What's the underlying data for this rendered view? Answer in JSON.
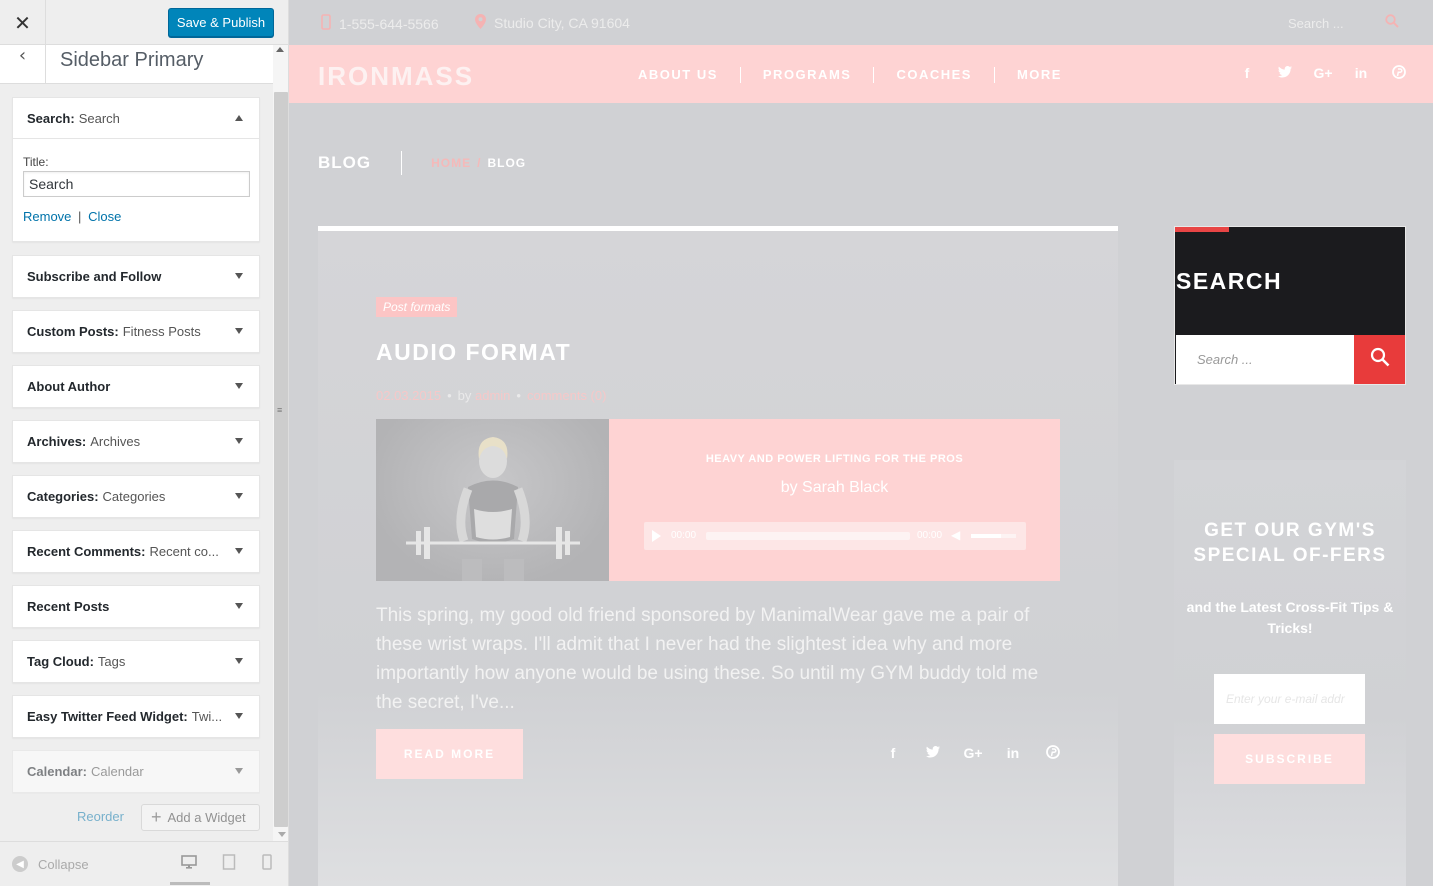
{
  "panel": {
    "close_glyph": "✕",
    "save_label": "Save & Publish",
    "back_glyph": "‹",
    "section_title": "Sidebar Primary",
    "search_widget": {
      "name": "Search:",
      "sub": "Search",
      "title_label": "Title:",
      "title_value": "Search",
      "remove_label": "Remove",
      "separator": "|",
      "close_label": "Close"
    },
    "widgets": [
      {
        "name": "Subscribe and Follow",
        "sub": ""
      },
      {
        "name": "Custom Posts:",
        "sub": "Fitness Posts"
      },
      {
        "name": "About Author",
        "sub": ""
      },
      {
        "name": "Archives:",
        "sub": "Archives"
      },
      {
        "name": "Categories:",
        "sub": "Categories"
      },
      {
        "name": "Recent Comments:",
        "sub": "Recent co..."
      },
      {
        "name": "Recent Posts",
        "sub": ""
      },
      {
        "name": "Tag Cloud:",
        "sub": "Tags"
      },
      {
        "name": "Easy Twitter Feed Widget:",
        "sub": "Twi..."
      },
      {
        "name": "Calendar:",
        "sub": "Calendar"
      }
    ],
    "reorder_label": "Reorder",
    "add_widget_label": "Add a Widget",
    "collapse_label": "Collapse",
    "scroll_grip": "≡"
  },
  "site": {
    "topbar": {
      "phone": "1-555-644-5566",
      "location": "Studio City, CA 91604",
      "search_placeholder": "Search ..."
    },
    "logo": "IRONMASS",
    "nav": [
      "ABOUT US",
      "PROGRAMS",
      "COACHES",
      "MORE"
    ],
    "social": [
      "f",
      "t",
      "G+",
      "in",
      "p"
    ],
    "page_title": "BLOG",
    "breadcrumb": {
      "home": "HOME",
      "sep": "/",
      "current": "BLOG"
    },
    "post": {
      "tag": "Post formats",
      "title": "AUDIO FORMAT",
      "date": "02.03.2015",
      "by": "by",
      "author": "admin",
      "comments": "comments (0)",
      "audio_title": "HEAVY AND POWER LIFTING FOR THE PROS",
      "audio_artist": "by Sarah Black",
      "time_start": "00:00",
      "time_end": "00:00",
      "excerpt": "This spring, my good old friend sponsored by ManimalWear gave me a pair of these wrist wraps. I'll admit that I never had the slightest idea why and more importantly how anyone would be using these. So until my GYM buddy told me the secret, I've...",
      "read_more": "READ MORE"
    },
    "search_widget": {
      "title": "SEARCH",
      "placeholder": "Search ..."
    },
    "subscribe_widget": {
      "title": "GET OUR GYM'S SPECIAL OF-FERS",
      "text": "and the Latest Cross-Fit Tips & Tricks!",
      "email_placeholder": "Enter your e-mail addr",
      "button": "SUBSCRIBE"
    }
  },
  "colors": {
    "wp_blue": "#0085ba",
    "link_blue": "#0073aa",
    "site_pink": "#fed3d3",
    "accent_red": "#e83b3b",
    "dark": "#1b1b1e"
  }
}
